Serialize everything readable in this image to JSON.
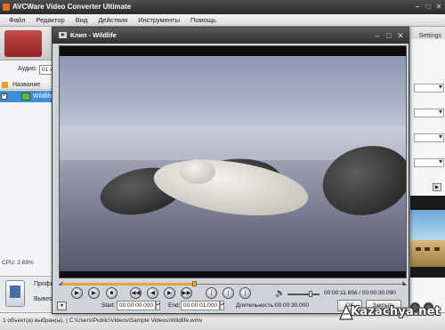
{
  "main": {
    "title": "AVCWare Video Converter Ultimate",
    "menu": [
      "Файл",
      "Редактор",
      "Вид",
      "Действия",
      "Инструменты",
      "Помощь"
    ],
    "settings_label": "Settings",
    "audio_label": "Аудио:",
    "audio_value": "01 x",
    "list_header_name": "Название",
    "file_name": "Wildlife",
    "cpu": "CPU: 2.69%",
    "profile_label": "Профи",
    "output_label": "Вывест",
    "status_text": "1 объект(а) выбран(ы). | C:\\Users\\Public\\Videos\\Sample Videos\\Wildlife.wmv"
  },
  "player": {
    "title": "Клип - Wildlife",
    "time_current": "00:00:11.656",
    "time_total": "00:00:30.090",
    "time_display": "00:00:11.656 / 00:00:30.090",
    "progress": 0.387,
    "volume": 0.72,
    "start_label": "Start:",
    "start_value": "00:00:00.000",
    "end_label": "End:",
    "end_value": "00:00:01.000",
    "duration_label": "Длительность:",
    "duration_value": "00:00:30.000",
    "ok_label": "OK",
    "close_label": "Закрыть",
    "buttons": {
      "play": "▶",
      "play_step": "▶",
      "stop": "■",
      "prev": "◀◀",
      "rewind": "◀",
      "forward": "▶",
      "next": "▶▶",
      "mark_in": "[",
      "mark_split": "|",
      "mark_out": "]"
    }
  },
  "watermark": {
    "text": "Kazachya.net"
  },
  "colors": {
    "accent": "#e3a33a",
    "selection": "#3f8fd6",
    "title_dark": "#2e2e2e"
  }
}
